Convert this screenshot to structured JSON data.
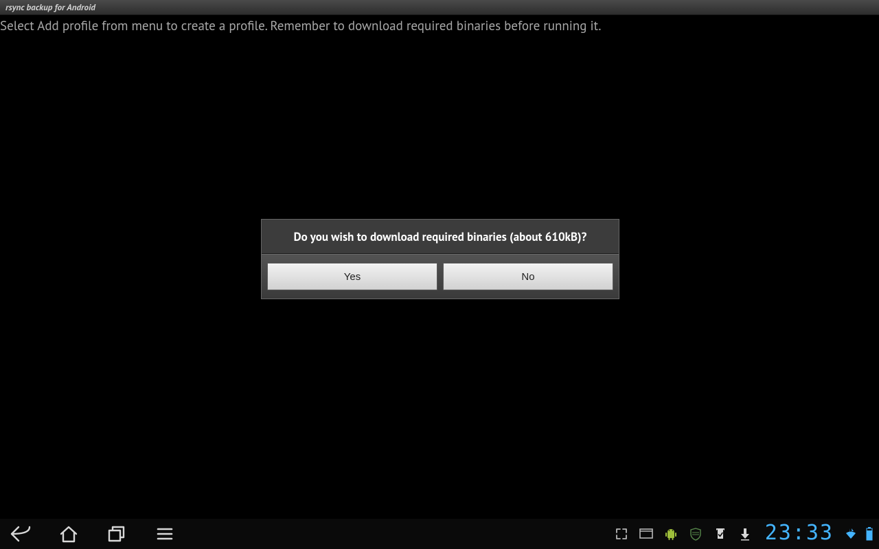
{
  "title_bar": {
    "app_title": "rsync backup for Android"
  },
  "content": {
    "instruction": "Select Add profile from menu to create a profile. Remember to download required binaries before running it."
  },
  "dialog": {
    "message": "Do you wish to download required binaries (about 610kB)?",
    "yes_label": "Yes",
    "no_label": "No"
  },
  "statusbar": {
    "time": "23:33"
  }
}
